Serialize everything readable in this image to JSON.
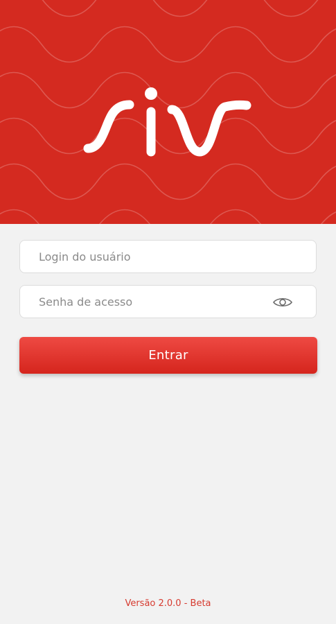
{
  "header": {
    "logo_text": "siv"
  },
  "login": {
    "username_placeholder": "Login do usuário",
    "password_placeholder": "Senha de acesso",
    "password_toggle_icon": "eye-icon",
    "submit_label": "Entrar"
  },
  "footer": {
    "version": "Versão 2.0.0 - Beta"
  },
  "colors": {
    "brand_red": "#d42a20",
    "button_top": "#ee4a43",
    "button_bottom": "#d5251d",
    "background": "#f2f2f2",
    "version_text": "#d63a2f"
  }
}
